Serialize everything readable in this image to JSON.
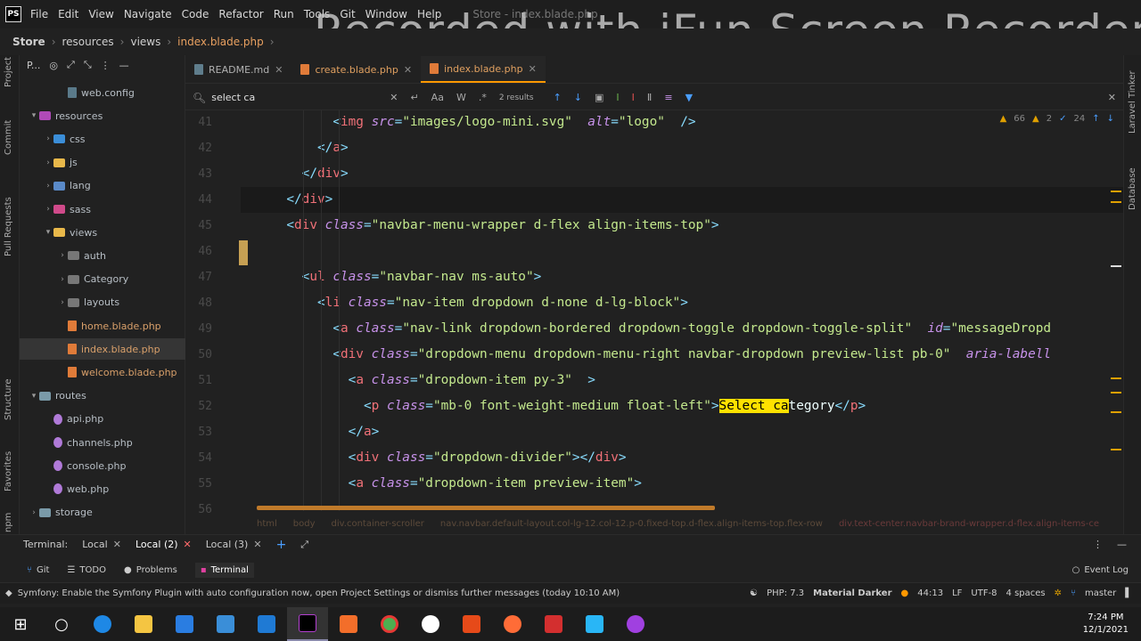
{
  "menubar": {
    "items": [
      "File",
      "Edit",
      "View",
      "Navigate",
      "Code",
      "Refactor",
      "Run",
      "Tools",
      "Git",
      "Window",
      "Help"
    ],
    "window_title": "Store - index.blade.php",
    "logo": "PS"
  },
  "watermark": "Recorded with iFun Screen Recorder",
  "breadcrumb": [
    "Store",
    "resources",
    "views",
    "index.blade.php"
  ],
  "left_strip": [
    "Project",
    "Commit",
    "Pull Requests",
    "Structure",
    "Favorites",
    "npm"
  ],
  "project_panel": {
    "header": "P...",
    "items": [
      {
        "label": "web.config",
        "kind": "file",
        "level": 2
      },
      {
        "label": "resources",
        "kind": "folder",
        "level": 0,
        "expanded": true
      },
      {
        "label": "css",
        "kind": "folder",
        "level": 1
      },
      {
        "label": "js",
        "kind": "folder",
        "level": 1
      },
      {
        "label": "lang",
        "kind": "folder",
        "level": 1
      },
      {
        "label": "sass",
        "kind": "folder",
        "level": 1
      },
      {
        "label": "views",
        "kind": "folder",
        "level": 1,
        "expanded": true
      },
      {
        "label": "auth",
        "kind": "folder",
        "level": 2
      },
      {
        "label": "Category",
        "kind": "folder",
        "level": 2
      },
      {
        "label": "layouts",
        "kind": "folder",
        "level": 2
      },
      {
        "label": "home.blade.php",
        "kind": "file",
        "level": 2
      },
      {
        "label": "index.blade.php",
        "kind": "file",
        "level": 2,
        "selected": true
      },
      {
        "label": "welcome.blade.php",
        "kind": "file",
        "level": 2
      },
      {
        "label": "routes",
        "kind": "folder",
        "level": 0,
        "expanded": true
      },
      {
        "label": "api.php",
        "kind": "php",
        "level": 1
      },
      {
        "label": "channels.php",
        "kind": "php",
        "level": 1
      },
      {
        "label": "console.php",
        "kind": "php",
        "level": 1
      },
      {
        "label": "web.php",
        "kind": "php",
        "level": 1
      },
      {
        "label": "storage",
        "kind": "folder",
        "level": 0
      }
    ]
  },
  "tabs": [
    {
      "label": "README.md",
      "active": false
    },
    {
      "label": "create.blade.php",
      "active": false
    },
    {
      "label": "index.blade.php",
      "active": true
    }
  ],
  "search": {
    "value": "select ca",
    "results": "2 results",
    "case_label": "Aa",
    "word_label": "W",
    "regex_label": ".*"
  },
  "inspections": {
    "warnings": "66",
    "weak": "2",
    "typos": "24"
  },
  "code_lines": [
    {
      "n": "41",
      "segs": [
        [
          "    ",
          "tx"
        ],
        [
          "<",
          "pu"
        ],
        [
          "img ",
          "tg"
        ],
        [
          "src",
          "at"
        ],
        [
          "=",
          "pu"
        ],
        [
          "\"images/logo-mini.svg\"",
          "st"
        ],
        [
          " ",
          "tx"
        ],
        [
          "alt",
          "at"
        ],
        [
          "=",
          "pu"
        ],
        [
          "\"logo\"",
          "st"
        ],
        [
          " />",
          "pu"
        ]
      ]
    },
    {
      "n": "42",
      "segs": [
        [
          "   ",
          "tx"
        ],
        [
          "</",
          "pu"
        ],
        [
          "a",
          "tg"
        ],
        [
          ">",
          "pu"
        ]
      ]
    },
    {
      "n": "43",
      "segs": [
        [
          "  ",
          "tx"
        ],
        [
          "</",
          "pu"
        ],
        [
          "div",
          "tg"
        ],
        [
          ">",
          "pu"
        ]
      ]
    },
    {
      "n": "44",
      "segs": [
        [
          " ",
          "tx"
        ],
        [
          "</",
          "pu"
        ],
        [
          "div",
          "tg"
        ],
        [
          ">",
          "pu"
        ]
      ],
      "current": true
    },
    {
      "n": "45",
      "segs": [
        [
          " ",
          "tx"
        ],
        [
          "<",
          "pu"
        ],
        [
          "div ",
          "tg"
        ],
        [
          "class",
          "at"
        ],
        [
          "=",
          "pu"
        ],
        [
          "\"navbar-menu-wrapper d-flex align-items-top\"",
          "st"
        ],
        [
          ">",
          "pu"
        ]
      ]
    },
    {
      "n": "46",
      "segs": []
    },
    {
      "n": "47",
      "segs": [
        [
          "  ",
          "tx"
        ],
        [
          "<",
          "pu"
        ],
        [
          "ul ",
          "tg"
        ],
        [
          "class",
          "at"
        ],
        [
          "=",
          "pu"
        ],
        [
          "\"navbar-nav ms-auto\"",
          "st"
        ],
        [
          ">",
          "pu"
        ]
      ]
    },
    {
      "n": "48",
      "segs": [
        [
          "   ",
          "tx"
        ],
        [
          "<",
          "pu"
        ],
        [
          "li ",
          "tg"
        ],
        [
          "class",
          "at"
        ],
        [
          "=",
          "pu"
        ],
        [
          "\"nav-item dropdown d-none d-lg-block\"",
          "st"
        ],
        [
          ">",
          "pu"
        ]
      ]
    },
    {
      "n": "49",
      "segs": [
        [
          "    ",
          "tx"
        ],
        [
          "<",
          "pu"
        ],
        [
          "a ",
          "tg"
        ],
        [
          "class",
          "at"
        ],
        [
          "=",
          "pu"
        ],
        [
          "\"nav-link dropdown-bordered dropdown-toggle dropdown-toggle-split\"",
          "st"
        ],
        [
          " ",
          "tx"
        ],
        [
          "id",
          "at"
        ],
        [
          "=",
          "pu"
        ],
        [
          "\"messageDropd",
          "st"
        ]
      ]
    },
    {
      "n": "50",
      "segs": [
        [
          "    ",
          "tx"
        ],
        [
          "<",
          "pu"
        ],
        [
          "div ",
          "tg"
        ],
        [
          "class",
          "at"
        ],
        [
          "=",
          "pu"
        ],
        [
          "\"dropdown-menu dropdown-menu-right navbar-dropdown preview-list pb-0\"",
          "st"
        ],
        [
          " ",
          "tx"
        ],
        [
          "aria-labell",
          "at"
        ]
      ]
    },
    {
      "n": "51",
      "segs": [
        [
          "     ",
          "tx"
        ],
        [
          "<",
          "pu"
        ],
        [
          "a ",
          "tg"
        ],
        [
          "class",
          "at"
        ],
        [
          "=",
          "pu"
        ],
        [
          "\"dropdown-item py-3\"",
          "st"
        ],
        [
          " >",
          "pu"
        ]
      ]
    },
    {
      "n": "52",
      "segs": [
        [
          "      ",
          "tx"
        ],
        [
          "<",
          "pu"
        ],
        [
          "p ",
          "tg"
        ],
        [
          "class",
          "at"
        ],
        [
          "=",
          "pu"
        ],
        [
          "\"mb-0 font-weight-medium float-left\"",
          "st"
        ],
        [
          ">",
          "pu"
        ],
        [
          "Select ca",
          "hl"
        ],
        [
          "tegory",
          "tx"
        ],
        [
          "</",
          "pu"
        ],
        [
          "p",
          "tg"
        ],
        [
          ">",
          "pu"
        ]
      ]
    },
    {
      "n": "53",
      "segs": [
        [
          "     ",
          "tx"
        ],
        [
          "</",
          "pu"
        ],
        [
          "a",
          "tg"
        ],
        [
          ">",
          "pu"
        ]
      ]
    },
    {
      "n": "54",
      "segs": [
        [
          "     ",
          "tx"
        ],
        [
          "<",
          "pu"
        ],
        [
          "div ",
          "tg"
        ],
        [
          "class",
          "at"
        ],
        [
          "=",
          "pu"
        ],
        [
          "\"dropdown-divider\"",
          "st"
        ],
        [
          "></",
          "pu"
        ],
        [
          "div",
          "tg"
        ],
        [
          ">",
          "pu"
        ]
      ]
    },
    {
      "n": "55",
      "segs": [
        [
          "     ",
          "tx"
        ],
        [
          "<",
          "pu"
        ],
        [
          "a ",
          "tg"
        ],
        [
          "class",
          "at"
        ],
        [
          "=",
          "pu"
        ],
        [
          "\"dropdown-item preview-item\"",
          "st"
        ],
        [
          ">",
          "pu"
        ]
      ]
    },
    {
      "n": "56",
      "segs": []
    }
  ],
  "editor_breadcrumbs": [
    "html",
    "body",
    "div.container-scroller",
    "nav.navbar.default-layout.col-lg-12.col-12.p-0.fixed-top.d-flex.align-items-top.flex-row",
    "div.text-center.navbar-brand-wrapper.d-flex.align-items-ce"
  ],
  "right_strip": [
    "Laravel Tinker",
    "Database"
  ],
  "terminal": {
    "label": "Terminal:",
    "tabs": [
      {
        "label": "Local",
        "active": false
      },
      {
        "label": "Local (2)",
        "active": true
      },
      {
        "label": "Local (3)",
        "active": false
      }
    ]
  },
  "tool_buttons": [
    {
      "label": "Git",
      "active": false
    },
    {
      "label": "TODO",
      "active": false
    },
    {
      "label": "Problems",
      "active": false
    },
    {
      "label": "Terminal",
      "active": true
    }
  ],
  "event_log": "Event Log",
  "status": {
    "message": "Symfony: Enable the Symfony Plugin with auto configuration now, open Project Settings or dismiss further messages (today 10:10 AM)",
    "php": "PHP: 7.3",
    "theme": "Material Darker",
    "position": "44:13",
    "line_sep": "LF",
    "encoding": "UTF-8",
    "indent": "4 spaces",
    "branch": "master"
  },
  "taskbar": {
    "time": "7:24 PM",
    "date": "12/1/2021"
  },
  "colors": {
    "accent": "#ff9800",
    "tag": "#f07178",
    "attr": "#c792ea",
    "string": "#c3e88d",
    "punct": "#89ddff",
    "match": "#ffe100"
  }
}
